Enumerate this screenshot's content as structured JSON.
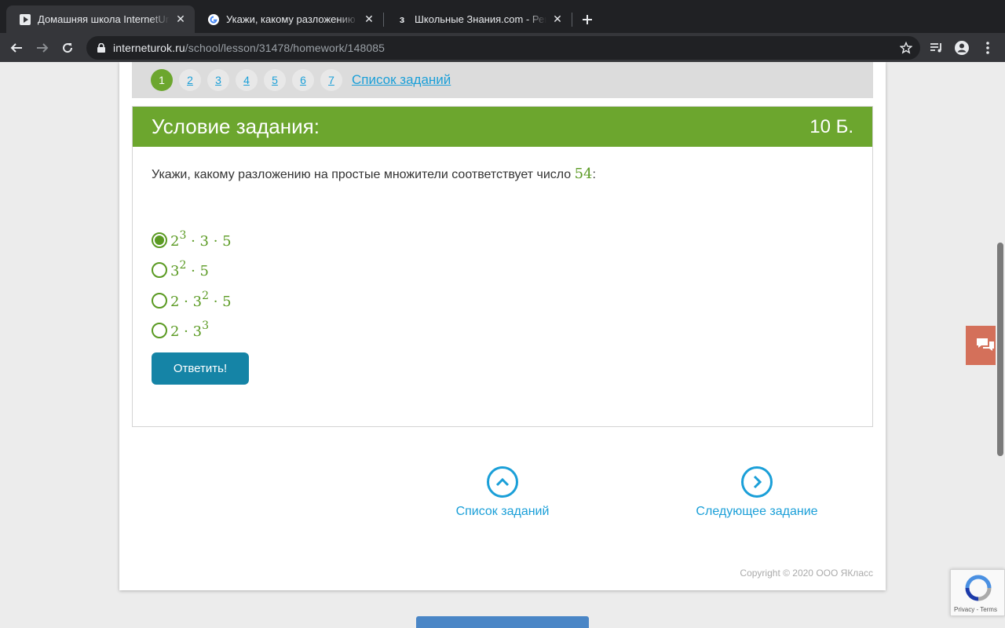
{
  "browser": {
    "tabs": [
      {
        "title": "Домашняя школа InternetUrok",
        "active": true,
        "favicon": "play-icon"
      },
      {
        "title": "Укажи, какому разложению на",
        "active": false,
        "favicon": "google-icon"
      },
      {
        "title": "Школьные Знания.com - Реша",
        "active": false,
        "favicon": "znania-icon"
      }
    ],
    "url_host": "interneturok.ru",
    "url_path": "/school/lesson/31478/homework/148085"
  },
  "pager": {
    "items": [
      "1",
      "2",
      "3",
      "4",
      "5",
      "6",
      "7"
    ],
    "current": "1",
    "list_link": "Список заданий"
  },
  "task": {
    "title": "Условие задания:",
    "points": "10 Б.",
    "question_text": "Укажи, какому разложению на простые множители соответствует число ",
    "question_number": "54",
    "question_suffix": ":",
    "options": [
      {
        "base1": "2",
        "exp1": "3",
        "rest": " · 3 · 5",
        "selected": true
      },
      {
        "base1": "3",
        "exp1": "2",
        "rest": " · 5",
        "selected": false
      },
      {
        "pre": "2 · ",
        "base1": "3",
        "exp1": "2",
        "rest": " · 5",
        "selected": false
      },
      {
        "pre": "2 · ",
        "base1": "3",
        "exp1": "3",
        "rest": "",
        "selected": false
      }
    ],
    "answer_button": "Ответить!"
  },
  "nav": {
    "list_label": "Список заданий",
    "next_label": "Следующее задание"
  },
  "footer": {
    "copyright": "Copyright © 2020 ООО ЯКласс"
  },
  "recaptcha": {
    "text": "Privacy - Terms"
  },
  "colors": {
    "green": "#6ca62e",
    "blue_link": "#1a9fd8",
    "button": "#1584a6",
    "chat": "#d4705a"
  }
}
